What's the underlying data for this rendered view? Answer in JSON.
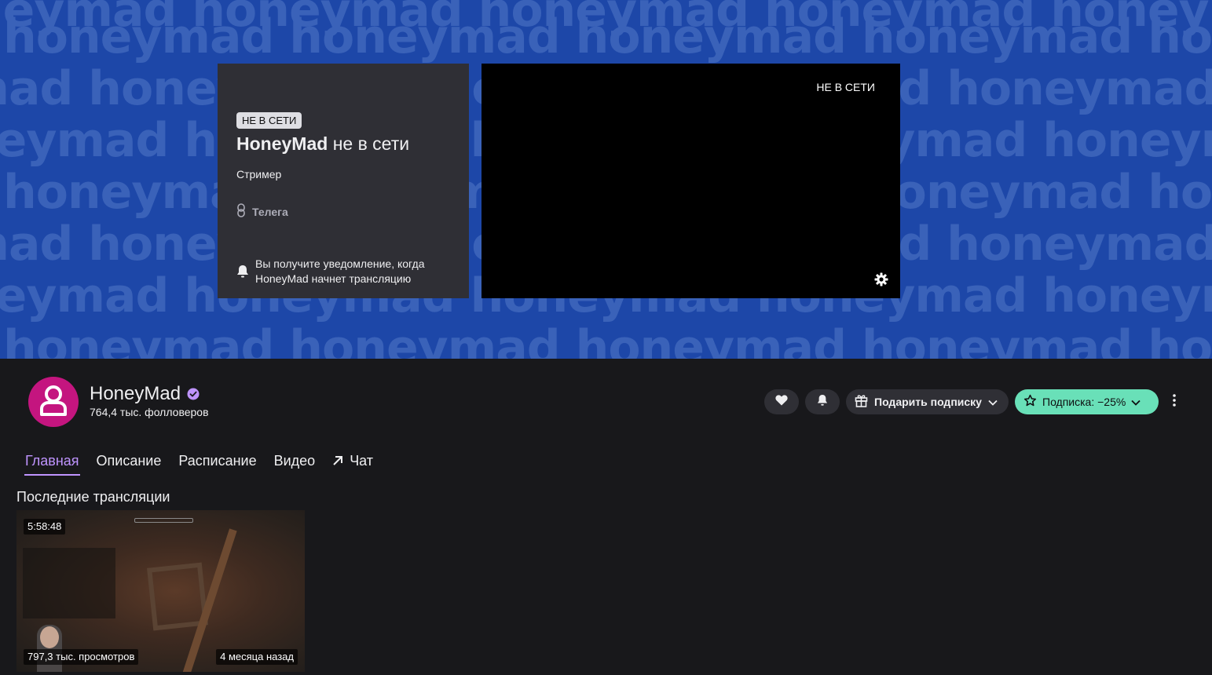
{
  "banner": {
    "watermark_text": "honeymad",
    "offline_card": {
      "badge": "НЕ В СЕТИ",
      "channel_name": "HoneyMad",
      "status_suffix": "не в сети",
      "role": "Стример",
      "link_label": "Телега",
      "notify_text": "Вы получите уведомление, когда HoneyMad начнет трансляцию"
    },
    "player": {
      "offline_label": "НЕ В СЕТИ"
    }
  },
  "channel": {
    "name": "HoneyMad",
    "followers": "764,4 тыс. фолловеров",
    "avatar_color": "#c4157f",
    "gift_label": "Подарить подписку",
    "subscribe_label": "Подписка: −25%"
  },
  "tabs": [
    {
      "label": "Главная",
      "active": true
    },
    {
      "label": "Описание"
    },
    {
      "label": "Расписание"
    },
    {
      "label": "Видео"
    },
    {
      "label": "Чат"
    }
  ],
  "recent": {
    "title": "Последние трансляции",
    "videos": [
      {
        "duration": "5:58:48",
        "views": "797,3 тыс. просмотров",
        "date": "4 месяца назад"
      }
    ]
  }
}
